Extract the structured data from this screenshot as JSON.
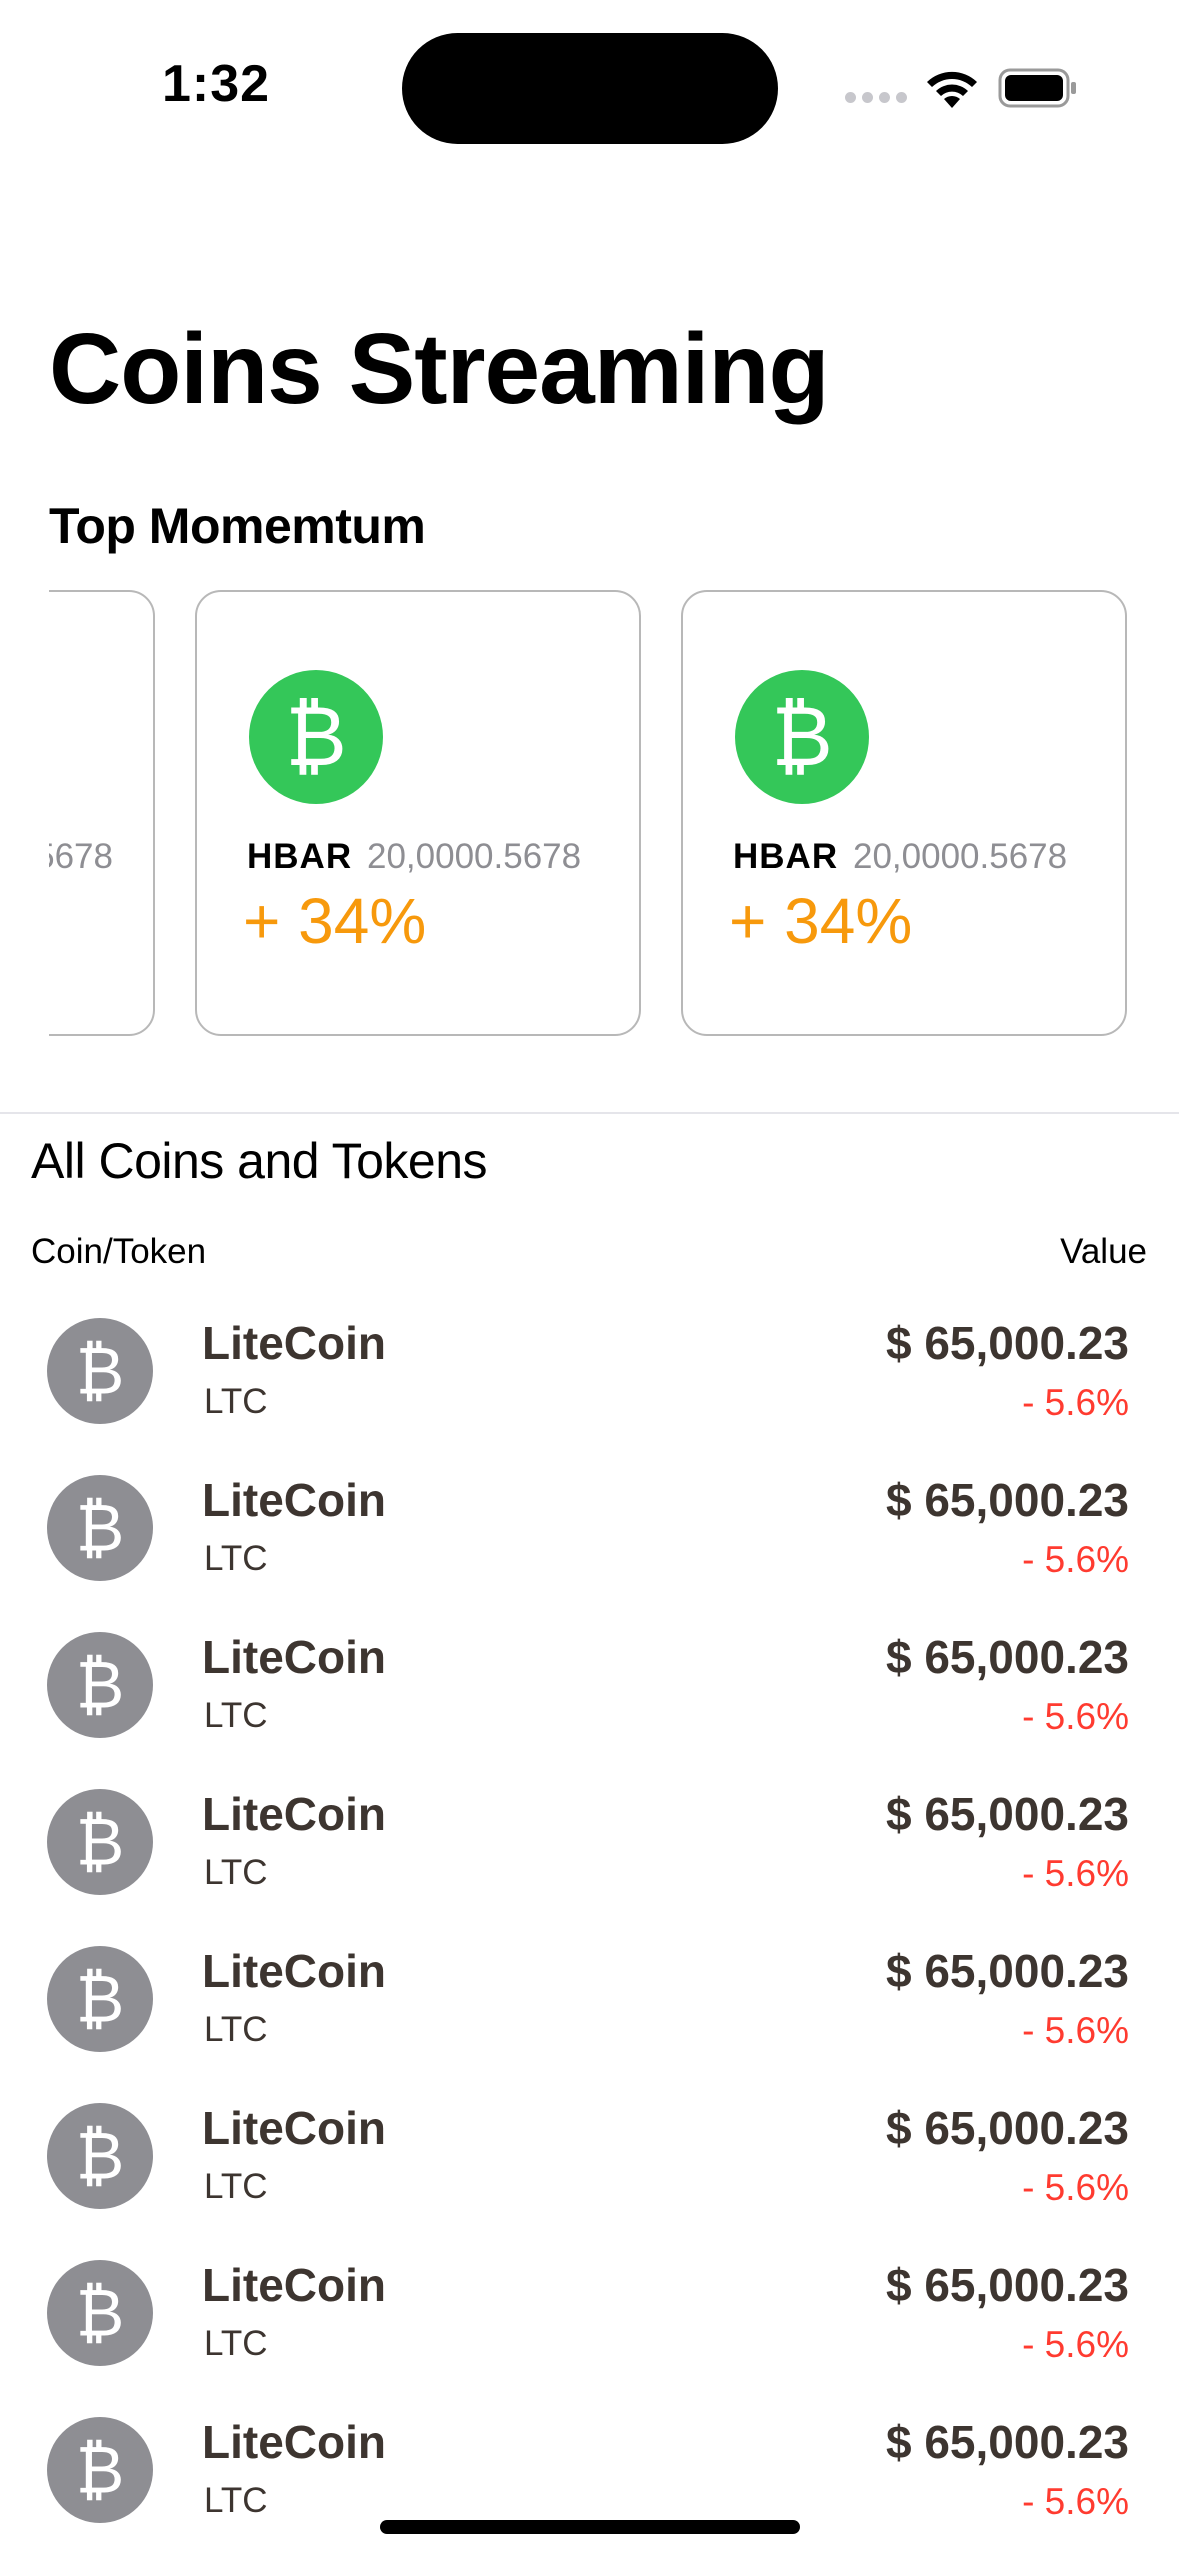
{
  "status_bar": {
    "time": "1:32"
  },
  "header": {
    "title": "Coins Streaming"
  },
  "top_momentum": {
    "heading": "Top Momemtum",
    "partial_card": {
      "amount_fragment": "5678"
    },
    "cards": [
      {
        "symbol": "HBAR",
        "amount": "20,0000.5678",
        "change": "+ 34%"
      },
      {
        "symbol": "HBAR",
        "amount": "20,0000.5678",
        "change": "+ 34%"
      }
    ]
  },
  "all_coins": {
    "heading": "All Coins and Tokens",
    "columns": {
      "left": "Coin/Token",
      "right": "Value"
    },
    "rows": [
      {
        "name": "LiteCoin",
        "ticker": "LTC",
        "price": "$ 65,000.23",
        "change": "- 5.6%"
      },
      {
        "name": "LiteCoin",
        "ticker": "LTC",
        "price": "$ 65,000.23",
        "change": "- 5.6%"
      },
      {
        "name": "LiteCoin",
        "ticker": "LTC",
        "price": "$ 65,000.23",
        "change": "- 5.6%"
      },
      {
        "name": "LiteCoin",
        "ticker": "LTC",
        "price": "$ 65,000.23",
        "change": "- 5.6%"
      },
      {
        "name": "LiteCoin",
        "ticker": "LTC",
        "price": "$ 65,000.23",
        "change": "- 5.6%"
      },
      {
        "name": "LiteCoin",
        "ticker": "LTC",
        "price": "$ 65,000.23",
        "change": "- 5.6%"
      },
      {
        "name": "LiteCoin",
        "ticker": "LTC",
        "price": "$ 65,000.23",
        "change": "- 5.6%"
      },
      {
        "name": "LiteCoin",
        "ticker": "LTC",
        "price": "$ 65,000.23",
        "change": "- 5.6%"
      }
    ]
  },
  "colors": {
    "accent_green": "#34c759",
    "positive_orange": "#f7990c",
    "negative_red": "#ff3b30",
    "coin_gray": "#8e8e93"
  },
  "icons": {
    "coin_icon": "bitcoin-sign-icon",
    "status": [
      "cellular-signal-icon",
      "wifi-icon",
      "battery-icon"
    ]
  }
}
